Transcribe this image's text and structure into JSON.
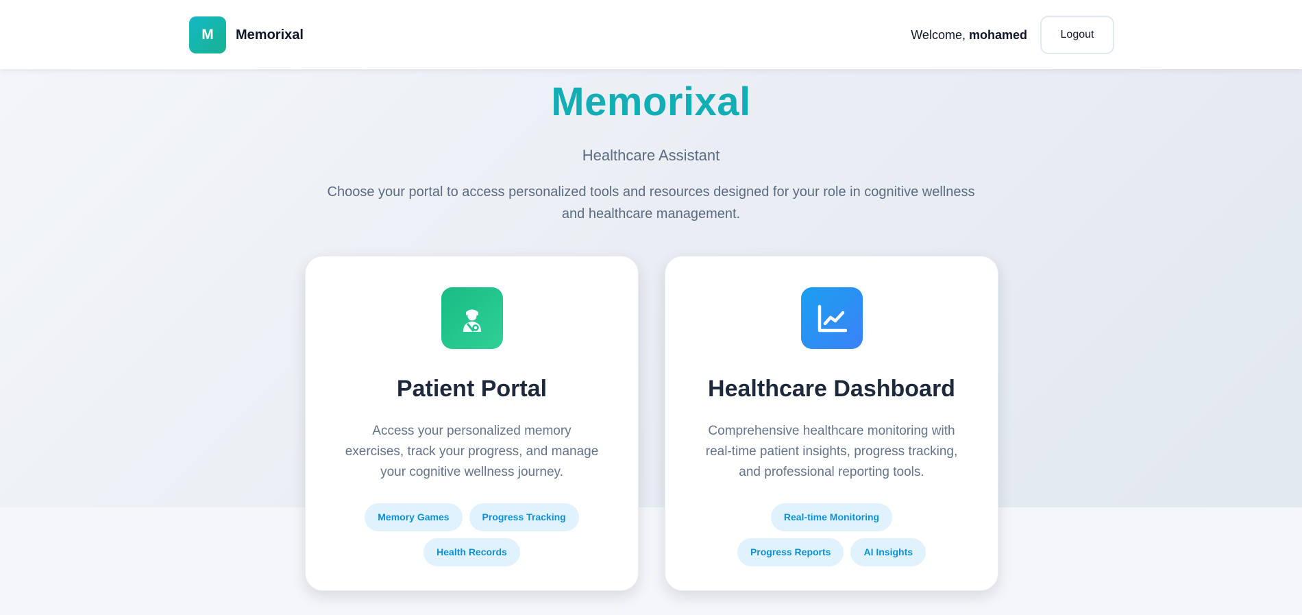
{
  "header": {
    "logo_letter": "M",
    "brand_name": "Memorixal",
    "welcome_prefix": "Welcome, ",
    "username": "mohamed",
    "logout_label": "Logout"
  },
  "hero": {
    "title": "Memorixal",
    "subtitle": "Healthcare Assistant",
    "description": "Choose your portal to access personalized tools and resources designed for your role in cognitive wellness and healthcare management."
  },
  "cards": [
    {
      "icon": "patient-icon",
      "title": "Patient Portal",
      "description": "Access your personalized memory exercises, track your progress, and manage your cognitive wellness journey.",
      "tags": [
        "Memory Games",
        "Progress Tracking",
        "Health Records"
      ]
    },
    {
      "icon": "chart-line-icon",
      "title": "Healthcare Dashboard",
      "description": "Comprehensive healthcare monitoring with real-time patient insights, progress tracking, and professional reporting tools.",
      "tags": [
        "Real-time Monitoring",
        "Progress Reports",
        "AI Insights"
      ]
    }
  ],
  "colors": {
    "brand_teal": "#13adb5",
    "patient_green": "#17bd85",
    "dashboard_blue": "#1b9ff0",
    "tag_bg": "#e0f2fe",
    "tag_text": "#0e8fd1"
  }
}
